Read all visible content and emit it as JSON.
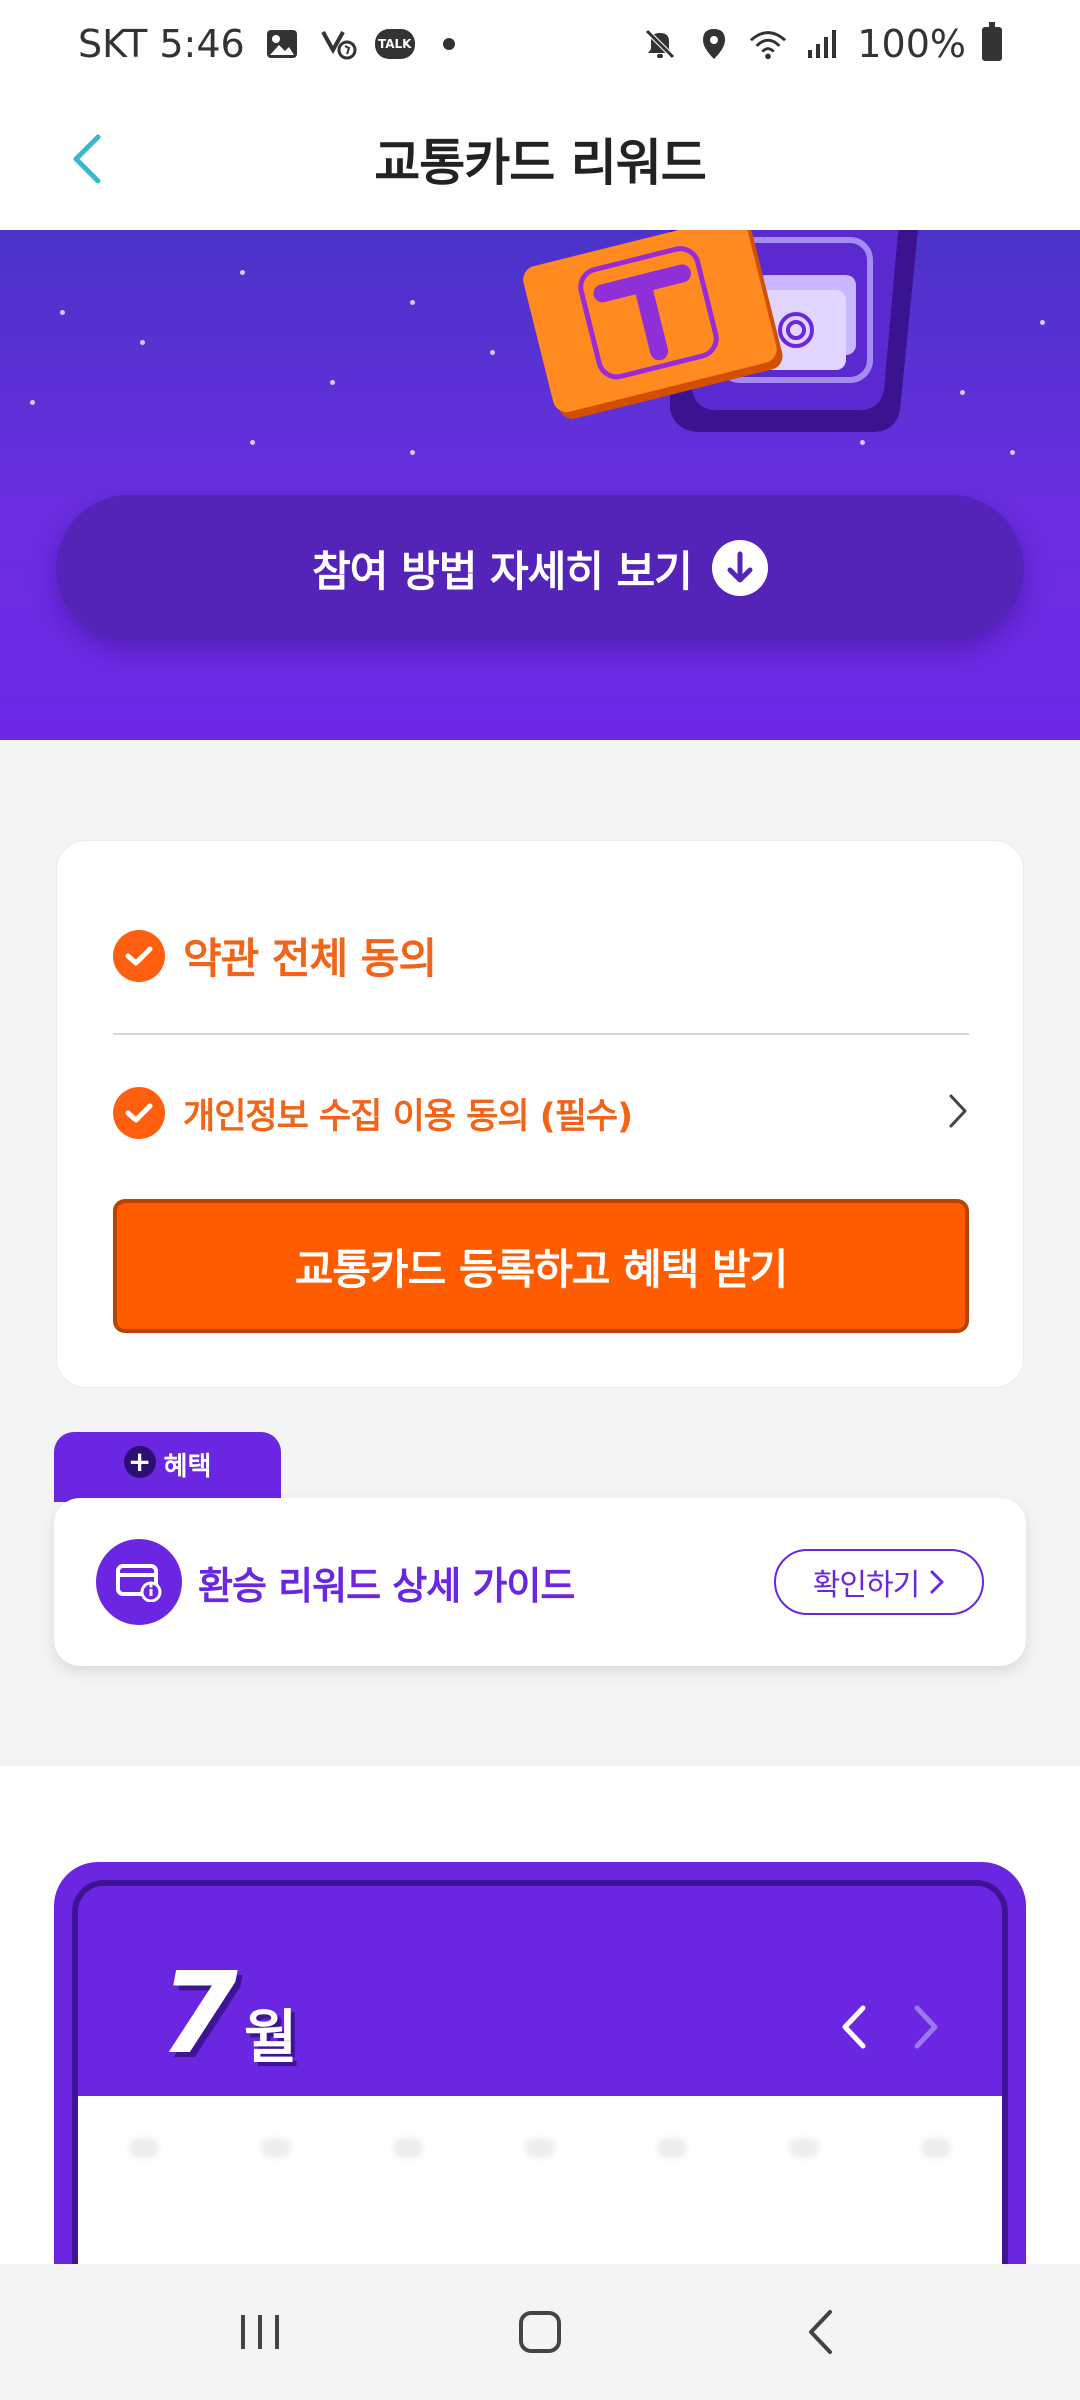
{
  "status_bar": {
    "carrier_time": "SKT 5:46",
    "battery": "100%",
    "icons": [
      "gallery-icon",
      "missed-call-icon",
      "kakaotalk-icon",
      "mute-icon",
      "location-icon",
      "wifi-icon",
      "signal-icon",
      "battery-icon"
    ],
    "talk_badge": "TALK"
  },
  "header": {
    "title": "교통카드 리워드",
    "back_icon": "chevron-left-icon"
  },
  "hero": {
    "button_label": "참여 방법 자세히 보기",
    "button_icon": "arrow-down-circle-icon"
  },
  "agreement": {
    "all_label": "약관 전체 동의",
    "item_label": "개인정보 수집 이용 동의 (필수)",
    "register_button": "교통카드 등록하고 혜택 받기"
  },
  "benefit": {
    "tab_label": "혜택",
    "guide_label": "환승 리워드 상세 가이드",
    "confirm_label": "확인하기"
  },
  "calendar": {
    "month_number": "7",
    "month_suffix": "월"
  },
  "colors": {
    "primary_purple": "#6a26e0",
    "accent_orange": "#ff5c00",
    "teal": "#3bb7c9"
  }
}
